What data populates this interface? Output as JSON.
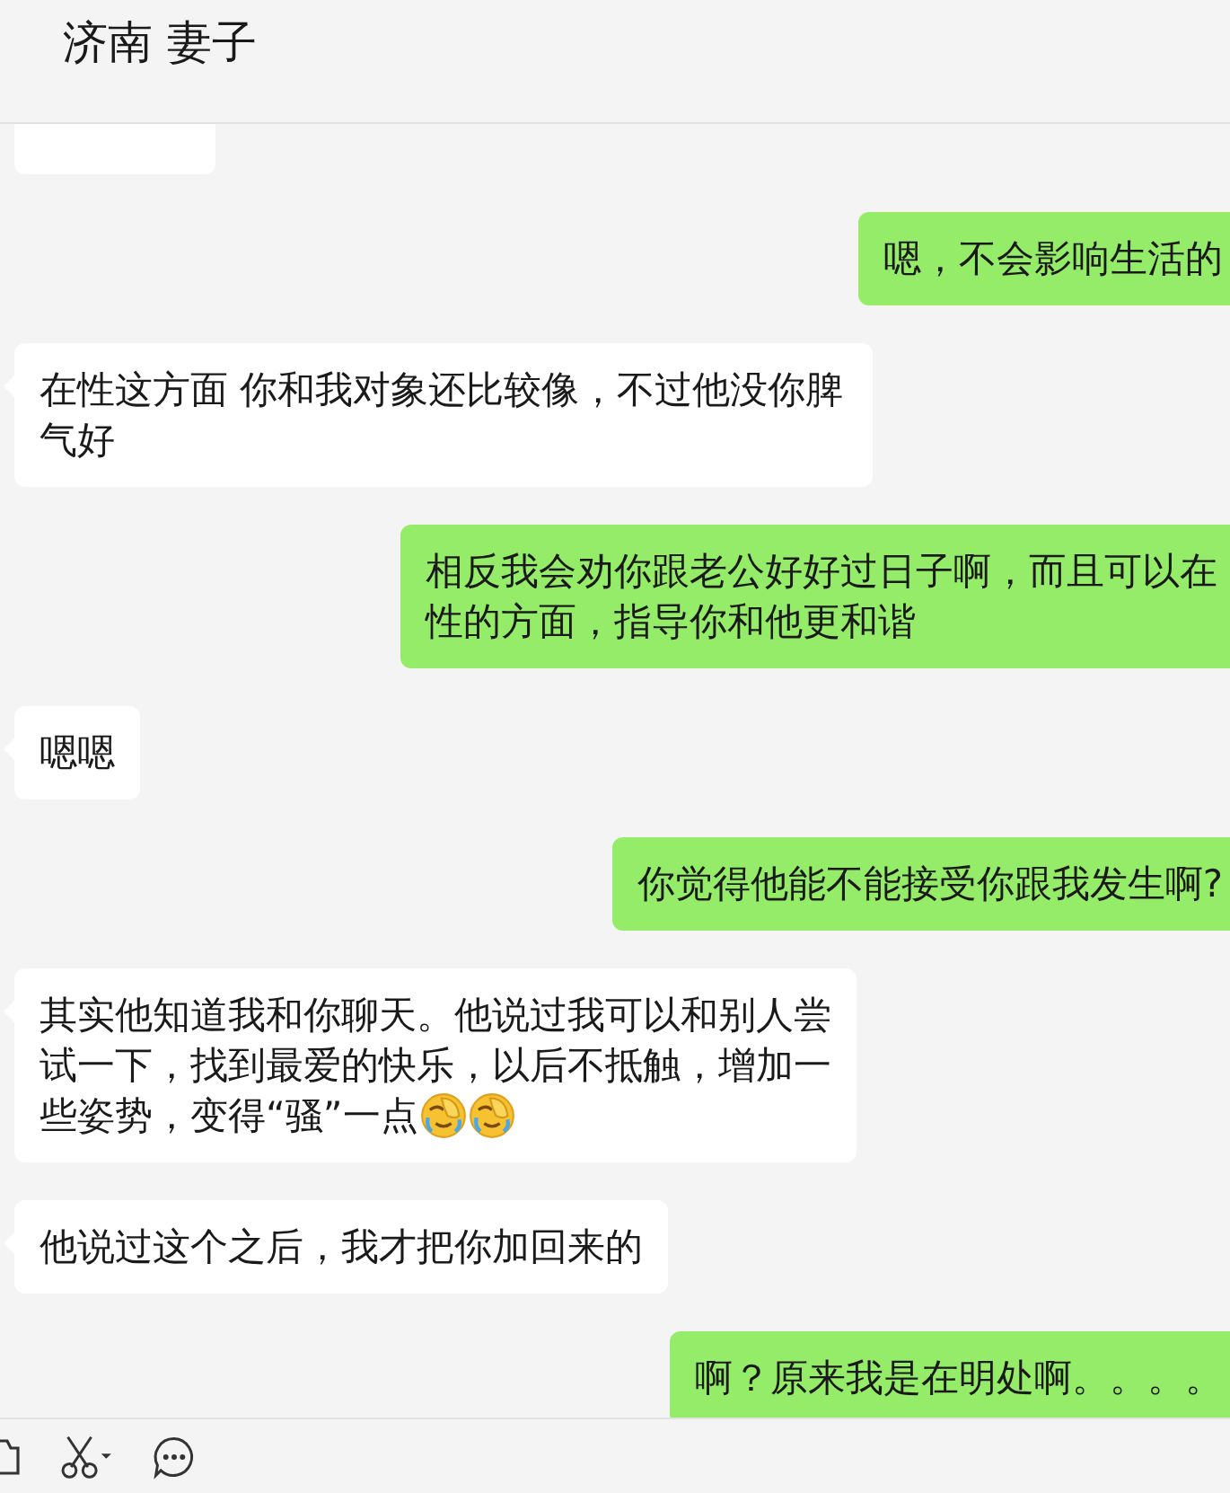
{
  "header": {
    "title": "济南 妻子"
  },
  "messages": [
    {
      "kind": "received_cut"
    },
    {
      "kind": "sent",
      "text": "嗯，不会影响生活的"
    },
    {
      "kind": "received",
      "text": "在性这方面 你和我对象还比较像，不过他没你脾气好"
    },
    {
      "kind": "sent",
      "text": "相反我会劝你跟老公好好过日子啊，而且可以在性的方面，指导你和他更和谐"
    },
    {
      "kind": "received",
      "text": "嗯嗯"
    },
    {
      "kind": "sent",
      "text": "你觉得他能不能接受你跟我发生啊?"
    },
    {
      "kind": "received",
      "text": "其实他知道我和你聊天。他说过我可以和别人尝试一下，找到最爱的快乐，以后不抵触，增加一",
      "tail": "些姿势，变得“骚”一点",
      "emojis": [
        {
          "kind": "facepalm"
        },
        {
          "kind": "facepalm"
        }
      ]
    },
    {
      "kind": "received",
      "text": "他说过这个之后，我才把你加回来的"
    },
    {
      "kind": "sent",
      "text": "啊？原来我是在明处啊。。。。"
    }
  ],
  "toolbar": [
    {
      "kind": "folder"
    },
    {
      "kind": "scissors"
    },
    {
      "kind": "chat"
    }
  ]
}
